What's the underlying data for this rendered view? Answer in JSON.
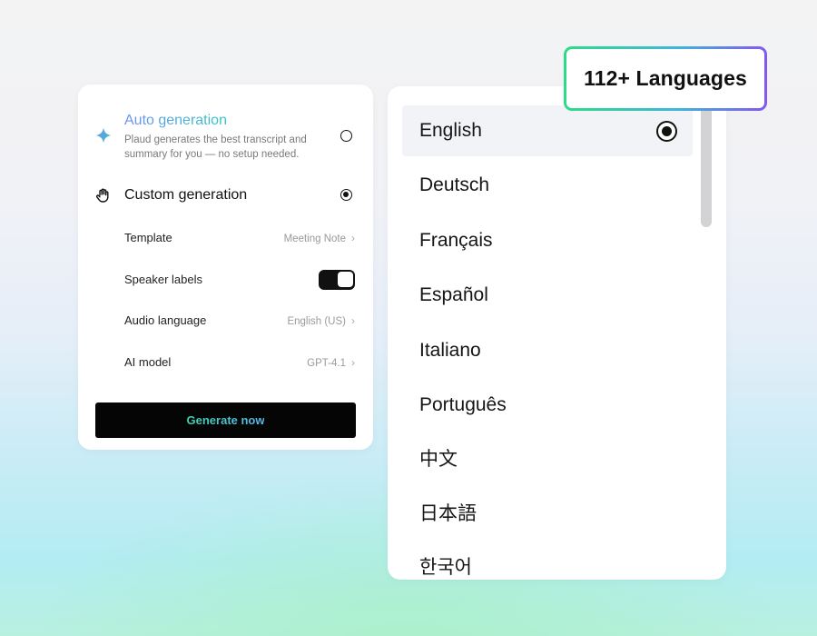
{
  "settings": {
    "auto": {
      "title": "Auto generation",
      "description": "Plaud generates the best transcript and summary for you — no setup needed.",
      "icon": "sparkle-icon",
      "selected": false
    },
    "custom": {
      "title": "Custom generation",
      "icon": "hand-icon",
      "selected": true
    },
    "rows": [
      {
        "label": "Template",
        "value": "Meeting Note"
      },
      {
        "label": "Speaker labels",
        "toggle": true
      },
      {
        "label": "Audio language",
        "value": "English (US)"
      },
      {
        "label": "AI model",
        "value": "GPT-4.1"
      }
    ],
    "generate_button": "Generate now"
  },
  "languages": {
    "selected": "English",
    "items": [
      "English",
      "Deutsch",
      "Français",
      "Español",
      "Italiano",
      "Português",
      "中文",
      "日本語",
      "한국어"
    ]
  },
  "badge": {
    "text": "112+ Languages"
  },
  "colors": {
    "accent_gradient": [
      "#6f8ff3",
      "#35c7c2"
    ],
    "button_text_gradient": [
      "#3fd2b0",
      "#56b9ee"
    ],
    "badge_border_gradient": [
      "#2ddc86",
      "#3fb6d9",
      "#8457f0"
    ]
  }
}
